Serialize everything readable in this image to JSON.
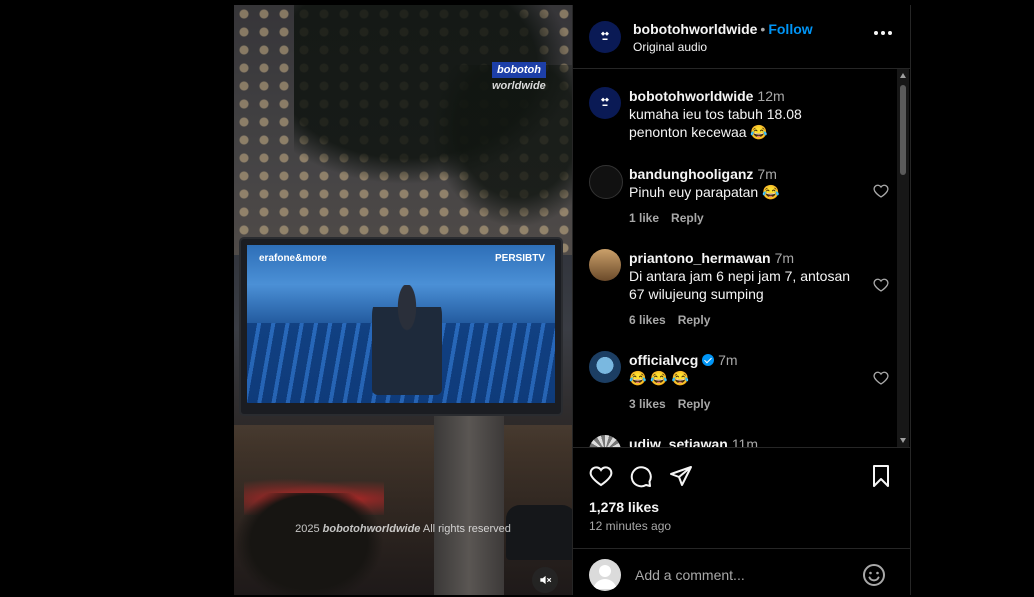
{
  "post": {
    "username": "bobotohworldwide",
    "separator": "•",
    "follow_label": "Follow",
    "audio": "Original audio"
  },
  "video": {
    "watermark_badge": "bobotoh",
    "watermark_sub": "worldwide",
    "screen_left_brand": "erafone&more",
    "screen_right_brand": "PERSIBTV",
    "copyright_year": "2025",
    "copyright_brand": "bobotohworldwide",
    "copyright_rest": "All rights reserved",
    "mute_icon": "speaker-muted-icon"
  },
  "comments": [
    {
      "username": "bobotohworldwide",
      "time": "12m",
      "text": "kumaha ieu tos tabuh 18.08 penonton kecewaa 😂",
      "likes": "",
      "reply": "",
      "verified": false
    },
    {
      "username": "bandunghooliganz",
      "time": "7m",
      "text": "Pinuh euy parapatan 😂",
      "likes": "1 like",
      "reply": "Reply",
      "verified": false
    },
    {
      "username": "priantono_hermawan",
      "time": "7m",
      "text": "Di antara jam 6 nepi jam 7, antosan 67 wilujeung sumping",
      "likes": "6 likes",
      "reply": "Reply",
      "verified": false
    },
    {
      "username": "officialvcg",
      "time": "7m",
      "text": "😂 😂 😂",
      "likes": "3 likes",
      "reply": "Reply",
      "verified": true
    },
    {
      "username": "udiw_setiawan",
      "time": "11m",
      "text": "",
      "likes": "",
      "reply": "",
      "verified": false
    }
  ],
  "engagement": {
    "likes": "1,278 likes",
    "time_ago": "12 minutes ago"
  },
  "composer": {
    "placeholder": "Add a comment..."
  },
  "colors": {
    "accent": "#0095f6",
    "background": "#000000",
    "muted_text": "#a8a8a8",
    "divider": "#262626"
  }
}
